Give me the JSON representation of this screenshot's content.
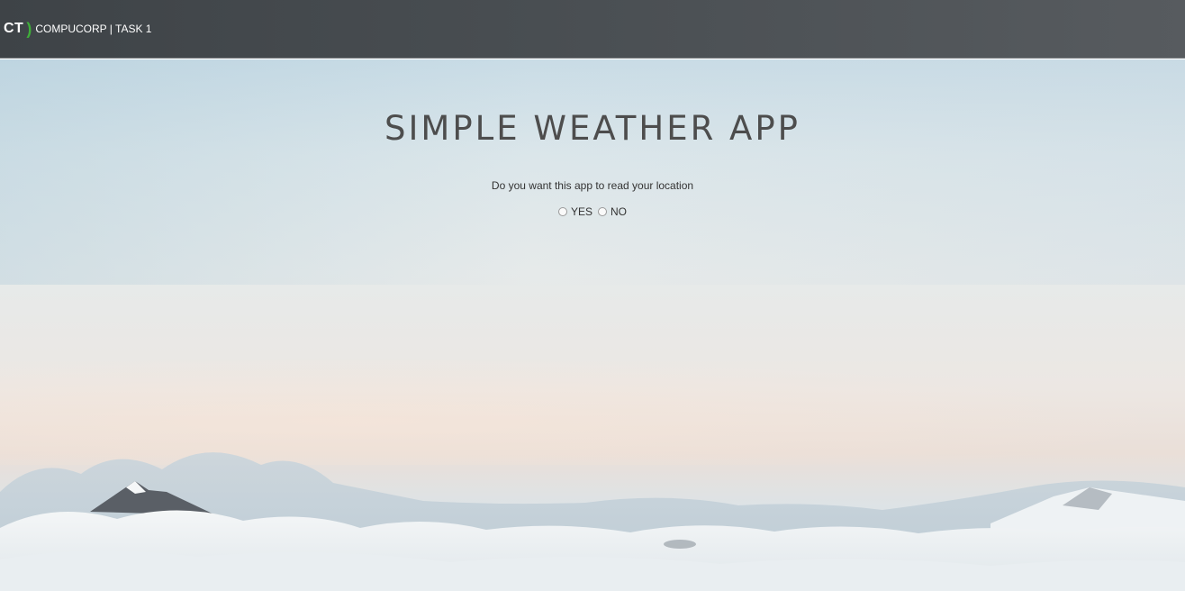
{
  "navbar": {
    "logo_ct": "CT",
    "logo_bracket": ")",
    "brand_text": "COMPUCORP | TASK 1"
  },
  "main": {
    "title": "SIMPLE WEATHER APP",
    "question": "Do you want this app to read your location",
    "options": [
      {
        "label": "YES",
        "selected": false
      },
      {
        "label": "NO",
        "selected": false
      }
    ]
  },
  "colors": {
    "navbar_bg": "#4a4f53",
    "logo_accent": "#3fae3a",
    "title_text": "#4d4d4d"
  }
}
